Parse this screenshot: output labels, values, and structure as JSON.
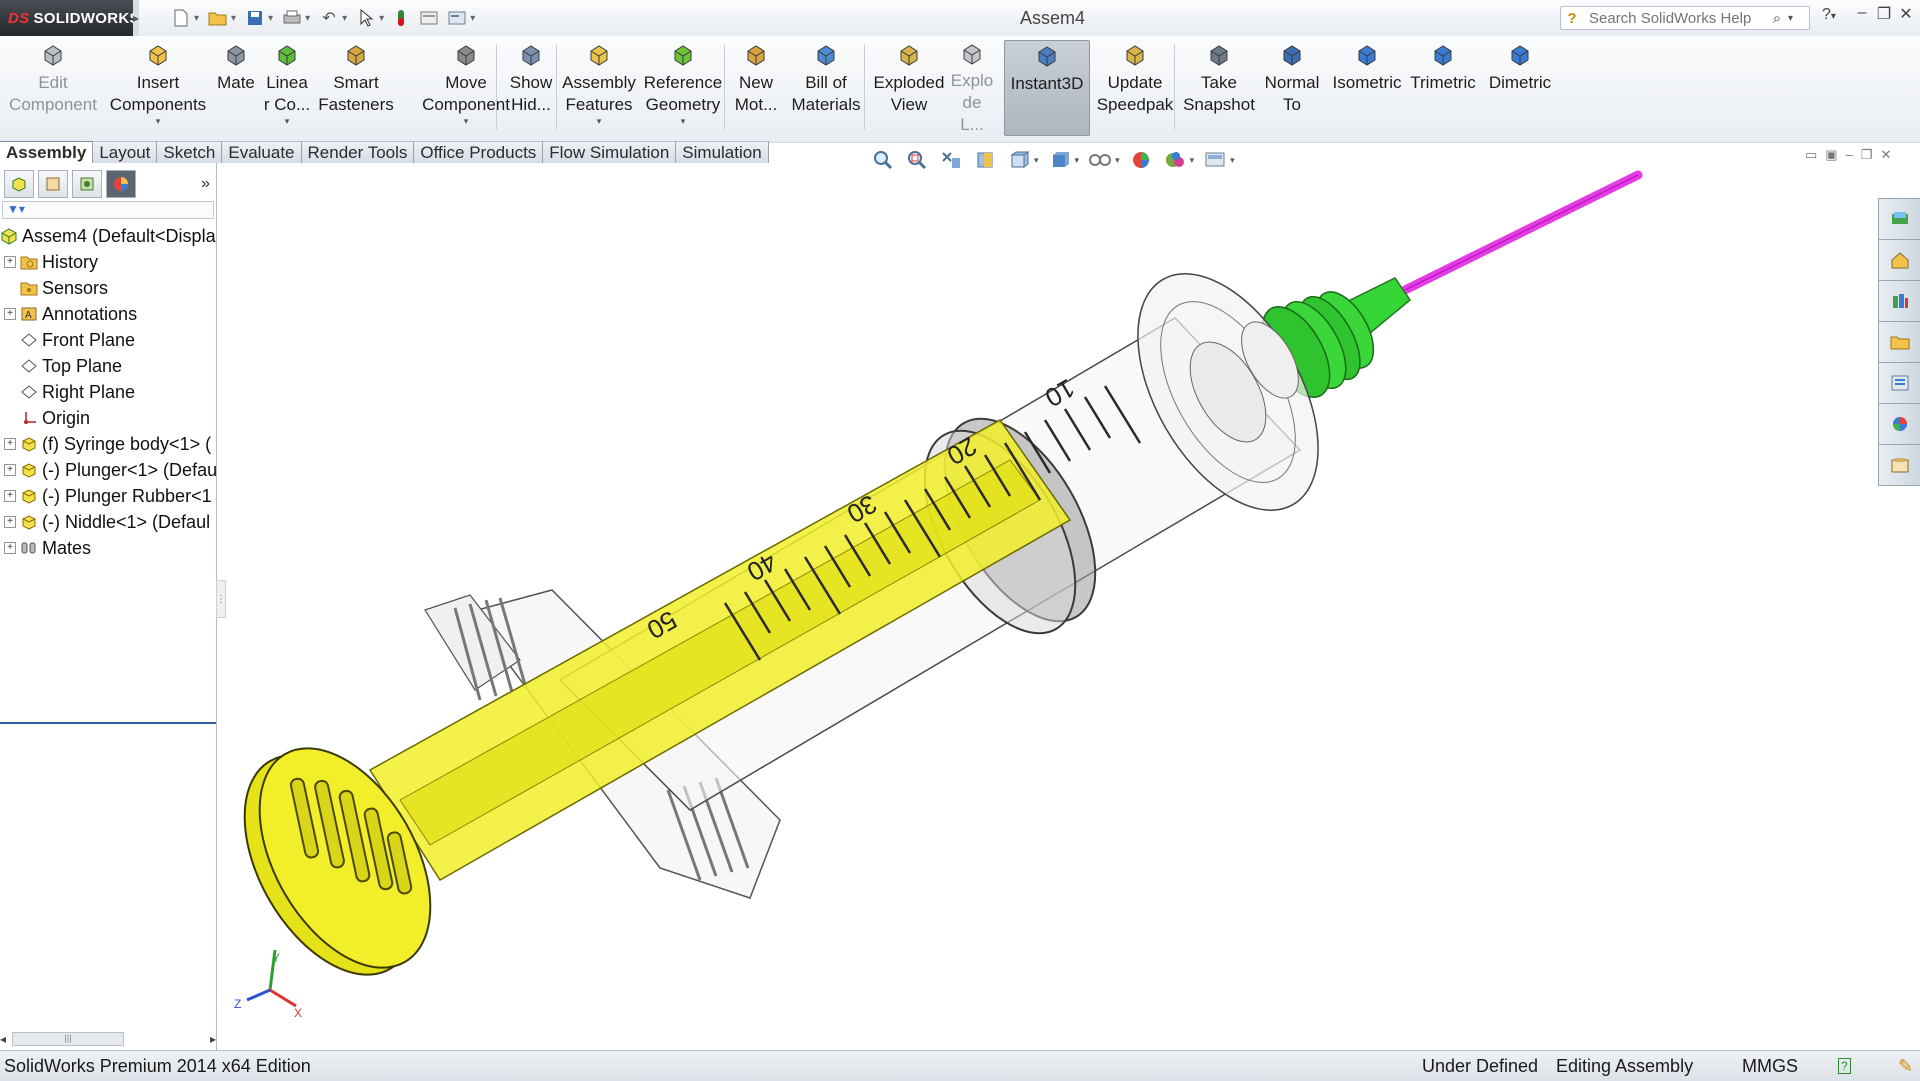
{
  "app": {
    "brand": "SOLIDWORKS",
    "brand_prefix": "DS",
    "window_title": "Assem4",
    "search_placeholder": "Search SolidWorks Help"
  },
  "command_manager": [
    {
      "id": "edit-component",
      "label": "Edit\nComponent",
      "disabled": true,
      "icon": "edit-component-icon"
    },
    {
      "id": "insert-components",
      "label": "Insert\nComponents",
      "dropdown": true,
      "icon": "insert-components-icon"
    },
    {
      "id": "mate",
      "label": "Mate",
      "icon": "mate-icon"
    },
    {
      "id": "linear-component-pattern",
      "label": "Linea\nr Co...",
      "dropdown": true,
      "icon": "linear-pattern-icon"
    },
    {
      "id": "smart-fasteners",
      "label": "Smart\nFasteners",
      "icon": "smart-fasteners-icon"
    },
    {
      "id": "move-component",
      "label": "Move\nComponent",
      "dropdown": true,
      "icon": "move-component-icon"
    },
    {
      "id": "show-hidden",
      "label": "Show\nHid...",
      "icon": "show-hidden-icon"
    },
    {
      "id": "assembly-features",
      "label": "Assembly\nFeatures",
      "dropdown": true,
      "icon": "assembly-features-icon"
    },
    {
      "id": "reference-geometry",
      "label": "Reference\nGeometry",
      "dropdown": true,
      "icon": "reference-geometry-icon"
    },
    {
      "id": "new-motion-study",
      "label": "New\nMot...",
      "icon": "new-motion-study-icon"
    },
    {
      "id": "bill-of-materials",
      "label": "Bill of\nMaterials",
      "icon": "bill-of-materials-icon"
    },
    {
      "id": "exploded-view",
      "label": "Exploded\nView",
      "icon": "exploded-view-icon"
    },
    {
      "id": "explode-line-sketch",
      "label": "Explo\nde L...",
      "disabled": true,
      "icon": "explode-line-sketch-icon"
    },
    {
      "id": "instant3d",
      "label": "Instant3D",
      "active": true,
      "icon": "instant3d-icon"
    },
    {
      "id": "update-speedpak",
      "label": "Update\nSpeedpak",
      "icon": "speedpak-icon"
    },
    {
      "id": "take-snapshot",
      "label": "Take\nSnapshot",
      "icon": "snapshot-icon"
    },
    {
      "id": "normal-to",
      "label": "Normal\nTo",
      "icon": "normal-to-icon"
    },
    {
      "id": "isometric",
      "label": "Isometric",
      "icon": "isometric-icon"
    },
    {
      "id": "trimetric",
      "label": "Trimetric",
      "icon": "trimetric-icon"
    },
    {
      "id": "dimetric",
      "label": "Dimetric",
      "icon": "dimetric-icon"
    }
  ],
  "tabs": [
    "Assembly",
    "Layout",
    "Sketch",
    "Evaluate",
    "Render Tools",
    "Office Products",
    "Flow Simulation",
    "Simulation"
  ],
  "active_tab": "Assembly",
  "feature_tree": [
    {
      "label": "Assem4  (Default<Displa",
      "icon": "assembly-icon",
      "expander": "none",
      "indent": 0
    },
    {
      "label": "History",
      "icon": "history-folder-icon",
      "expander": "+",
      "indent": 1
    },
    {
      "label": "Sensors",
      "icon": "sensors-folder-icon",
      "expander": "none",
      "indent": 1
    },
    {
      "label": "Annotations",
      "icon": "annotations-icon",
      "expander": "+",
      "indent": 1
    },
    {
      "label": "Front Plane",
      "icon": "plane-icon",
      "expander": "none",
      "indent": 1
    },
    {
      "label": "Top Plane",
      "icon": "plane-icon",
      "expander": "none",
      "indent": 1
    },
    {
      "label": "Right Plane",
      "icon": "plane-icon",
      "expander": "none",
      "indent": 1
    },
    {
      "label": "Origin",
      "icon": "origin-icon",
      "expander": "none",
      "indent": 1
    },
    {
      "label": "(f) Syringe body<1> (",
      "icon": "part-icon",
      "expander": "+",
      "indent": 1
    },
    {
      "label": "(-) Plunger<1> (Defau",
      "icon": "part-icon",
      "expander": "+",
      "indent": 1
    },
    {
      "label": "(-) Plunger Rubber<1",
      "icon": "part-icon",
      "expander": "+",
      "indent": 1
    },
    {
      "label": "(-) Niddle<1> (Defaul",
      "icon": "part-icon",
      "expander": "+",
      "indent": 1
    },
    {
      "label": "Mates",
      "icon": "mates-icon",
      "expander": "+",
      "indent": 1
    }
  ],
  "syringe_scale_labels": [
    "10",
    "20",
    "30",
    "40",
    "50"
  ],
  "triad_labels": {
    "x": "X",
    "y": "Y",
    "z": "Z"
  },
  "status": {
    "edition": "SolidWorks Premium 2014 x64 Edition",
    "definition": "Under Defined",
    "mode": "Editing Assembly",
    "units": "MMGS"
  },
  "colors": {
    "plunger": "#f2ef2a",
    "needle": "#e63ae6",
    "hub": "#2fd12f",
    "body_edge": "#3a3a3a",
    "active_tab_border": "#2f5f9f"
  }
}
